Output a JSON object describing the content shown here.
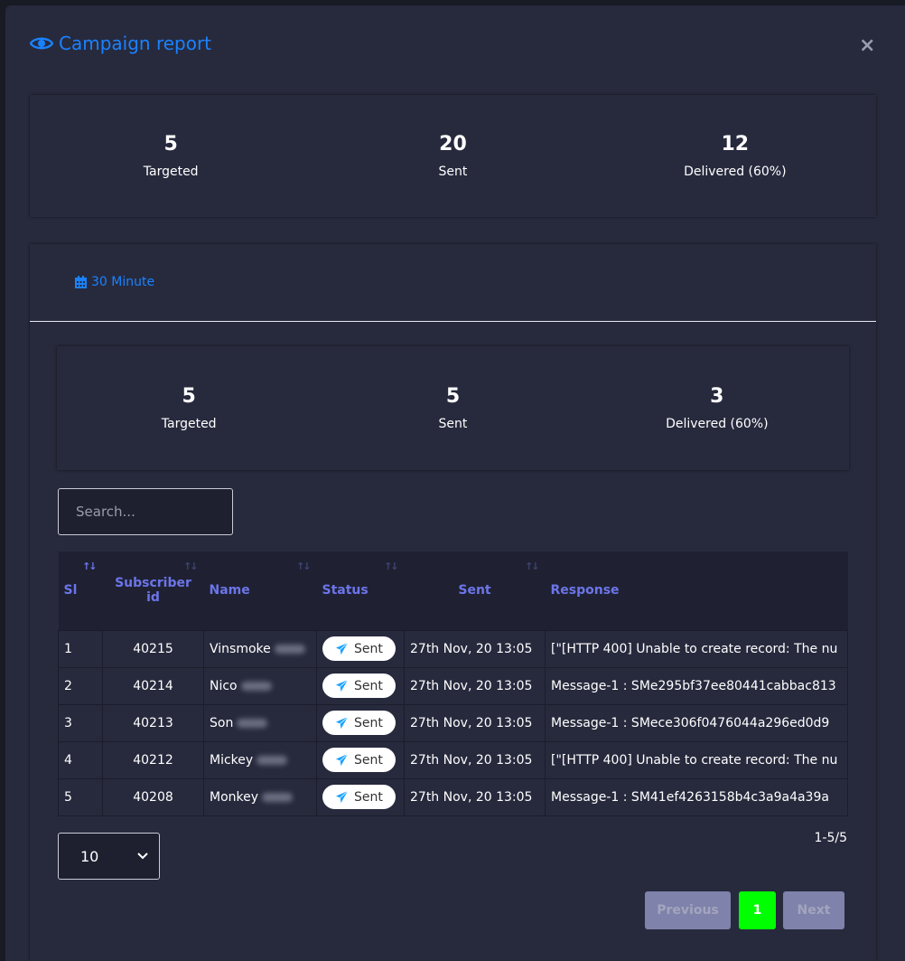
{
  "modal": {
    "title": "Campaign report",
    "title_icon": "eye-icon",
    "close_label": "×",
    "accent_color": "#1a82ff"
  },
  "summary": [
    {
      "value": "5",
      "label": "Targeted"
    },
    {
      "value": "20",
      "label": "Sent"
    },
    {
      "value": "12",
      "label": "Delivered (60%)"
    }
  ],
  "tab": {
    "label": "30 Minute",
    "icon": "calendar-icon"
  },
  "tab_summary": [
    {
      "value": "5",
      "label": "Targeted"
    },
    {
      "value": "5",
      "label": "Sent"
    },
    {
      "value": "3",
      "label": "Delivered (60%)"
    }
  ],
  "search": {
    "placeholder": "Search...",
    "value": ""
  },
  "table": {
    "columns": [
      "Sl",
      "Subscriber id",
      "Name",
      "Status",
      "Sent",
      "Response"
    ],
    "rows": [
      {
        "sl": "1",
        "sid": "40215",
        "name": "Vinsmoke",
        "status": "Sent",
        "sent": "27th Nov, 20 13:05",
        "response": "[\"[HTTP 400] Unable to create record: The nu"
      },
      {
        "sl": "2",
        "sid": "40214",
        "name": "Nico",
        "status": "Sent",
        "sent": "27th Nov, 20 13:05",
        "response": "Message-1 : SMe295bf37ee80441cabbac813"
      },
      {
        "sl": "3",
        "sid": "40213",
        "name": "Son",
        "status": "Sent",
        "sent": "27th Nov, 20 13:05",
        "response": "Message-1 : SMece306f0476044a296ed0d9"
      },
      {
        "sl": "4",
        "sid": "40212",
        "name": "Mickey",
        "status": "Sent",
        "sent": "27th Nov, 20 13:05",
        "response": "[\"[HTTP 400] Unable to create record: The nu"
      },
      {
        "sl": "5",
        "sid": "40208",
        "name": "Monkey",
        "status": "Sent",
        "sent": "27th Nov, 20 13:05",
        "response": "Message-1 : SM41ef4263158b4c3a9a4a39a"
      }
    ]
  },
  "page_size": "10",
  "range": "1-5/5",
  "pagination": {
    "previous": "Previous",
    "current": "1",
    "next": "Next",
    "active_color": "#00ff00"
  }
}
